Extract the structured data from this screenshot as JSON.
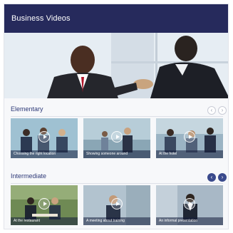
{
  "header": {
    "title": "Business Videos"
  },
  "sections": [
    {
      "title": "Elementary",
      "videos": [
        {
          "caption": "Choosing the right location"
        },
        {
          "caption": "Showing someone around"
        },
        {
          "caption": "At the hotel"
        }
      ],
      "nav": {
        "prev_icon": "chevron-left-icon",
        "next_icon": "chevron-right-icon",
        "prev": "‹",
        "next": "›"
      }
    },
    {
      "title": "Intermediate",
      "videos": [
        {
          "caption": "At the restaurant"
        },
        {
          "caption": "A meeting about training"
        },
        {
          "caption": "An informal presentation"
        }
      ],
      "nav": {
        "prev_icon": "chevron-left-icon",
        "next_icon": "chevron-right-icon",
        "prev": "‹",
        "next": "›"
      }
    }
  ],
  "colors": {
    "header_bg": "#262a5c",
    "accent": "#2e3a78"
  }
}
